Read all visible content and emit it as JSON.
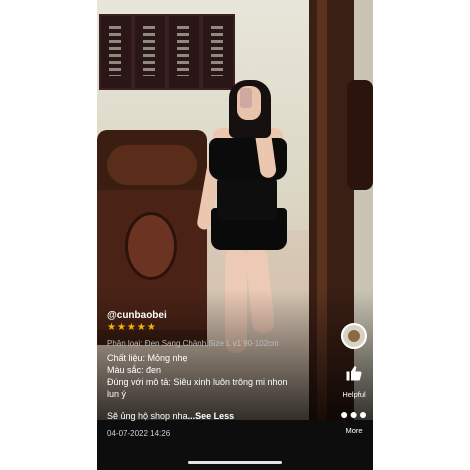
{
  "review": {
    "username": "@cunbaobei",
    "stars": "★★★★★",
    "variant": "Phân loại: Đen Sang Chảnh,Size L v1 90-102cm",
    "material": "Chất liệu: Mỏng nhẹ",
    "color": "Màu sắc: đen",
    "match_line1": "Đúng với mô tả: Siêu xinh luôn trông mi nhon",
    "match_line2": "lun ý",
    "comment": "Sẽ ủng hộ shop nha",
    "see_less": "...See Less",
    "date": "04-07-2022 14:26",
    "rating": 5
  },
  "actions": {
    "helpful_icon": "thumbs-up-icon",
    "helpful_label": "Helpful",
    "more_icon": "more-dots-icon",
    "more_label": "More"
  },
  "colors": {
    "star": "#f5b400",
    "text": "#ffffff",
    "muted": "#bdbdbd"
  }
}
